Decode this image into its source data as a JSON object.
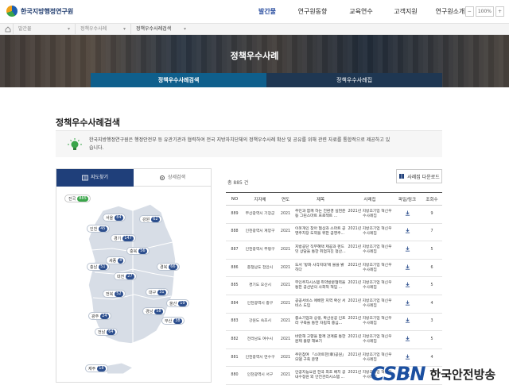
{
  "header": {
    "logo_text": "한국지방행정연구원",
    "nav": [
      "발간물",
      "연구원동향",
      "교육연수",
      "고객지원",
      "연구원소개"
    ],
    "active_nav": 0,
    "util": [
      "−",
      "100%",
      "+"
    ]
  },
  "breadcrumb": [
    "발간물",
    "정책우수사례",
    "정책우수사례검색"
  ],
  "hero": {
    "title": "정책우수사례",
    "tabs": [
      "정책우수사례검색",
      "정책우수사례집"
    ]
  },
  "page_title": "정책우수사례검색",
  "intro": "한국지방행정연구원은 행정안전부 등 유관기관과 협력하여 전국 지방자치단체의 정책우수사례 확산 및 공유를 위해 관련 자료를 통합적으로 제공하고 있습니다.",
  "left_panel": {
    "tabs": [
      "지도찾기",
      "상세검색"
    ],
    "all": {
      "label": "전국",
      "count": "885"
    },
    "regions": [
      {
        "label": "서울",
        "count": "84"
      },
      {
        "label": "인천",
        "count": "45"
      },
      {
        "label": "경기",
        "count": "147"
      },
      {
        "label": "강원",
        "count": "62"
      },
      {
        "label": "충북",
        "count": "56"
      },
      {
        "label": "세종",
        "count": "8"
      },
      {
        "label": "충남",
        "count": "51"
      },
      {
        "label": "대전",
        "count": "27"
      },
      {
        "label": "경북",
        "count": "66"
      },
      {
        "label": "전북",
        "count": "52"
      },
      {
        "label": "대구",
        "count": "31"
      },
      {
        "label": "울산",
        "count": "19"
      },
      {
        "label": "경남",
        "count": "58"
      },
      {
        "label": "광주",
        "count": "24"
      },
      {
        "label": "부산",
        "count": "38"
      },
      {
        "label": "전남",
        "count": "64"
      },
      {
        "label": "제주",
        "count": "18"
      }
    ]
  },
  "list": {
    "total": "총 885 건",
    "download_label": "사례집 다운로드",
    "columns": [
      "NO",
      "지자체",
      "연도",
      "제목",
      "사례집",
      "파일/링크",
      "조회수"
    ],
    "rows": [
      [
        "889",
        "부산광역시 기장군",
        "2021",
        "주민과 함께 하는 친환경 실현운동 그린스마트 프로젝트 ...",
        "2021년 지방조기업 혁신우수사례집",
        "9"
      ],
      [
        "888",
        "인천광역시 계양구",
        "2021",
        "이웃개인 찾아 협상과 스마트 공영주차장 도약을 위한 공영주...",
        "2021년 지방조기업 혁신우수사례집",
        "7"
      ],
      [
        "887",
        "인천광역시 부평구",
        "2021",
        "지방공단 직무혜택 제공과 펀드 잇 상담을 통한 취업처진 정산...",
        "2021년 지방조기업 혁신우수사례집",
        "5"
      ],
      [
        "886",
        "충청남도 천안시",
        "2021",
        "도서 '방화 사각지대'에 불을 밝히다",
        "2021년 지방조기업 혁신우수사례집",
        "6"
      ],
      [
        "885",
        "경기도 오산시",
        "2021",
        "무인주차시스템 취약방문협력을 통한 공선반의 사회적 책임 ...",
        "2021년 지방조기업 혁신우수사례집",
        "5"
      ],
      [
        "884",
        "인천광역시 중구",
        "2021",
        "공공서비스 에배한 지역 확산 서비스 도입",
        "2021년 지방조기업 혁신우수사례집",
        "4"
      ],
      [
        "883",
        "강원도 속초시",
        "2021",
        "중소기업과 상생, 확산성공 인프라 구축을 통한 자립적 중심...",
        "2021년 지방조기업 혁신우수사례집",
        "3"
      ],
      [
        "882",
        "전라남도 여수시",
        "2021",
        "바란해 고향을 함께 관계를 통한 문제 불량 해보기",
        "2021년 지방조기업 혁신우수사례집",
        "5"
      ],
      [
        "881",
        "인천광역시 연수구",
        "2021",
        "주민참여 「스마트한(幸)공원」 모델 구축 운영",
        "2021년 지방조기업 혁신우수사례집",
        "4"
      ],
      [
        "880",
        "인천광역시 서구",
        "2021",
        "안공지능요원 한국 최초 배치 공 내수정원 외 안전관리시스템 ...",
        "2021년 지방조기업 혁신우수사례집",
        "4"
      ]
    ]
  },
  "watermark": {
    "logo": "CSBN",
    "text": "한국안전방송"
  },
  "colors": {
    "brand": "#1f3f7a",
    "accent": "#0f5f8c",
    "badge": "#2d4f8e",
    "green": "#3aa54a"
  }
}
